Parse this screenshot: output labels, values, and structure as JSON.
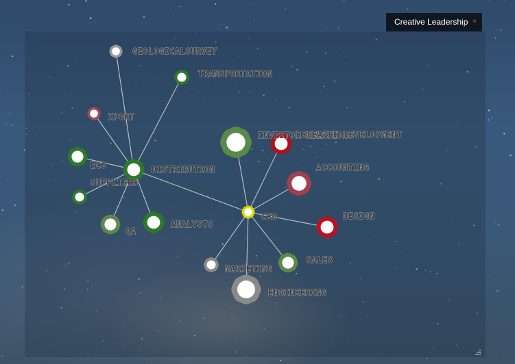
{
  "window": {
    "tab_title": "Creative Leadership",
    "close_symbol": "×",
    "accent_close": "#e0463a"
  },
  "graph": {
    "nodes": [
      {
        "id": "geologicalsurvey",
        "label": "GEOLOGICALSURVEY",
        "color": "#9a9a9a"
      },
      {
        "id": "transportation",
        "label": "TRANSPORTATION",
        "color": "#2b7a2b"
      },
      {
        "id": "xport",
        "label": "XPORT",
        "color": "#a04a5a"
      },
      {
        "id": "eco",
        "label": "ECO",
        "color": "#2b7a2b"
      },
      {
        "id": "suppliers",
        "label": "SUPPLIERS",
        "color": "#2b7a2b"
      },
      {
        "id": "distribution",
        "label": "DISTRIBUTION",
        "color": "#2b7a2b"
      },
      {
        "id": "qa",
        "label": "QA",
        "color": "#5a8a4a"
      },
      {
        "id": "analysts",
        "label": "ANALYSTS",
        "color": "#2b7a2b"
      },
      {
        "id": "investor-relations",
        "label": "INVESTOR RELATIONS",
        "color": "#5a8a4a"
      },
      {
        "id": "research-development",
        "label": "RESEARCH DEVELOPMENT",
        "color": "#b01020"
      },
      {
        "id": "accounting",
        "label": "ACCOUNTING",
        "color": "#a04050"
      },
      {
        "id": "ceo",
        "label": "CEO",
        "color": "#d8d800"
      },
      {
        "id": "design",
        "label": "DESIGN",
        "color": "#c01020"
      },
      {
        "id": "sales",
        "label": "SALES",
        "color": "#5a8a4a"
      },
      {
        "id": "marketing",
        "label": "MARKETING",
        "color": "#8a8a8a"
      },
      {
        "id": "engineering",
        "label": "ENGINEERING",
        "color": "#8a8a8a"
      }
    ],
    "edges": [
      [
        "distribution",
        "geologicalsurvey"
      ],
      [
        "distribution",
        "transportation"
      ],
      [
        "distribution",
        "xport"
      ],
      [
        "distribution",
        "eco"
      ],
      [
        "distribution",
        "suppliers"
      ],
      [
        "distribution",
        "qa"
      ],
      [
        "distribution",
        "analysts"
      ],
      [
        "distribution",
        "ceo"
      ],
      [
        "ceo",
        "investor-relations"
      ],
      [
        "ceo",
        "research-development"
      ],
      [
        "ceo",
        "accounting"
      ],
      [
        "ceo",
        "design"
      ],
      [
        "ceo",
        "sales"
      ],
      [
        "ceo",
        "marketing"
      ],
      [
        "ceo",
        "engineering"
      ]
    ]
  }
}
